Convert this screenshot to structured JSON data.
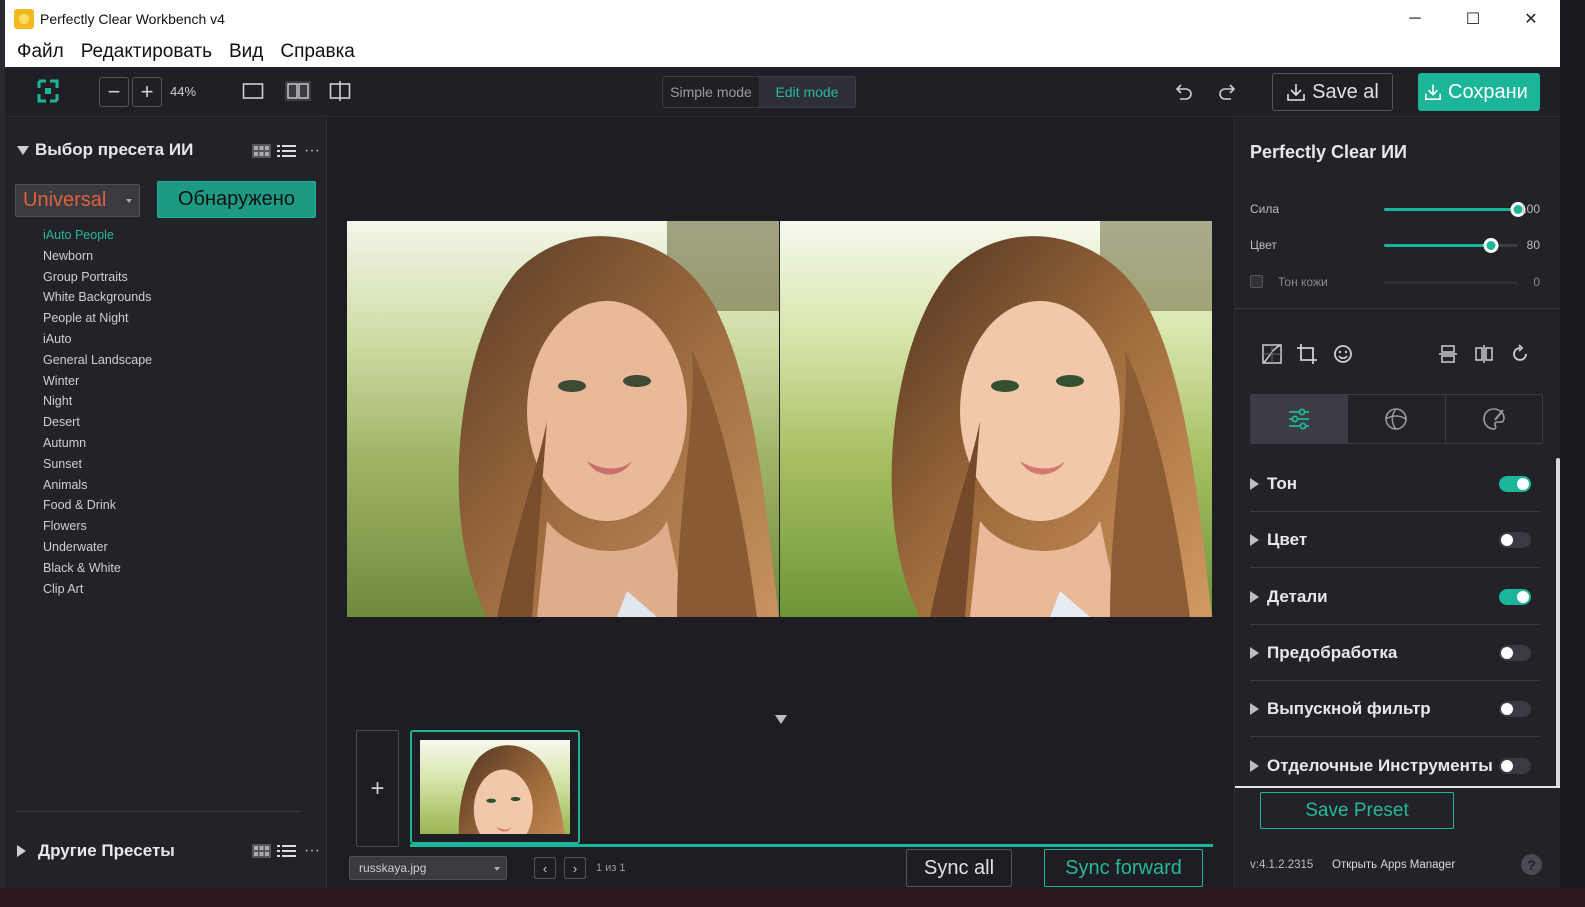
{
  "window": {
    "title": "Perfectly Clear Workbench v4",
    "controls": [
      "─",
      "☐",
      "✕"
    ]
  },
  "menu": [
    "Файл",
    "Редактировать",
    "Вид",
    "Справка"
  ],
  "toolbar": {
    "zoom_minus": "−",
    "zoom_plus": "+",
    "zoom_level": "44%",
    "modes": [
      "Simple mode",
      "Edit mode"
    ],
    "active_mode": "Edit mode",
    "save_all_label": "Save al",
    "save_label": "Сохрани"
  },
  "left_panel": {
    "header": "Выбор пресета ИИ",
    "preset_select": "Universal",
    "detected_button": "Обнаружено",
    "presets": [
      "iAuto People",
      "Newborn",
      "Group Portraits",
      "White Backgrounds",
      "People at Night",
      "iAuto",
      "General Landscape",
      "Winter",
      "Night",
      "Desert",
      "Autumn",
      "Sunset",
      "Animals",
      "Food & Drink",
      "Flowers",
      "Underwater",
      "Black & White",
      "Clip Art"
    ],
    "active_preset": "iAuto People",
    "footer": "Другие Пресеты",
    "more": "···"
  },
  "canvas": {
    "add_label": "+",
    "file_name": "russkaya.jpg",
    "prev": "‹",
    "next": "›",
    "page_info": "1 из 1",
    "sync_all": "Sync all",
    "sync_forward": "Sync forward"
  },
  "right_panel": {
    "title": "Perfectly Clear ИИ",
    "sliders": [
      {
        "label": "Сила",
        "value": "100",
        "fraction": 1.0
      },
      {
        "label": "Цвет",
        "value": "80",
        "fraction": 0.8
      },
      {
        "label": "Тон кожи",
        "value": "0",
        "fraction": 0.0,
        "disabled": true
      }
    ],
    "sections": [
      {
        "label": "Тон",
        "on": true
      },
      {
        "label": "Цвет",
        "on": false
      },
      {
        "label": "Детали",
        "on": true
      },
      {
        "label": "Предобработка",
        "on": false
      },
      {
        "label": "Выпускной фильтр",
        "on": false
      },
      {
        "label": "Отделочные Инструменты",
        "on": false
      }
    ],
    "save_preset": "Save Preset",
    "version": "v:4.1.2.2315",
    "apps_link": "Открыть Apps Manager",
    "help": "?"
  },
  "colors": {
    "accent": "#1bb69a",
    "preset_select_text": "#e0603c",
    "background": "#1d1d23",
    "panel": "#222228"
  }
}
